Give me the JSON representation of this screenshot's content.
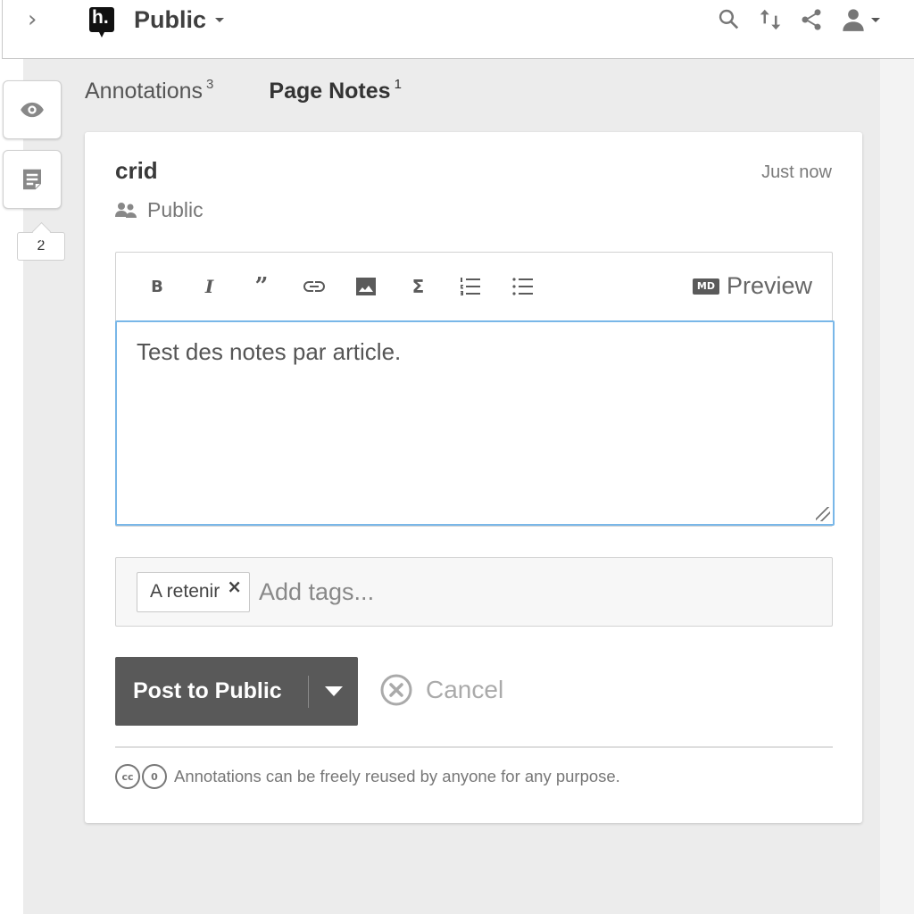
{
  "topbar": {
    "collapse_glyph": "›",
    "logo_text": "h.",
    "group_name": "Public",
    "icons": [
      "search-icon",
      "sort-icon",
      "share-icon",
      "user-icon"
    ]
  },
  "side": {
    "badge_count": "2"
  },
  "tabs": [
    {
      "label": "Annotations",
      "count": "3"
    },
    {
      "label": "Page Notes",
      "count": "1"
    }
  ],
  "note": {
    "author": "crid",
    "timestamp": "Just now",
    "privacy": "Public",
    "editor": {
      "toolbar": [
        "bold",
        "italic",
        "quote",
        "link",
        "image",
        "math",
        "numbered-list",
        "bulleted-list"
      ],
      "bold_glyph": "B",
      "italic_glyph": "I",
      "quote_glyph": "”",
      "sigma_glyph": "Σ",
      "preview_badge": "MD",
      "preview_label": "Preview",
      "text": "Test des notes par article."
    },
    "tags": {
      "items": [
        "A retenir"
      ],
      "remove_glyph": "×",
      "placeholder": "Add tags..."
    },
    "post_label": "Post to Public",
    "cancel_label": "Cancel",
    "license_text": "Annotations can be freely reused by anyone for any purpose.",
    "license_badges": [
      "cc",
      "0"
    ]
  },
  "colors": {
    "accent_focus": "#79b7e8",
    "post_button": "#595959",
    "sidebar_bg": "#ececec"
  }
}
